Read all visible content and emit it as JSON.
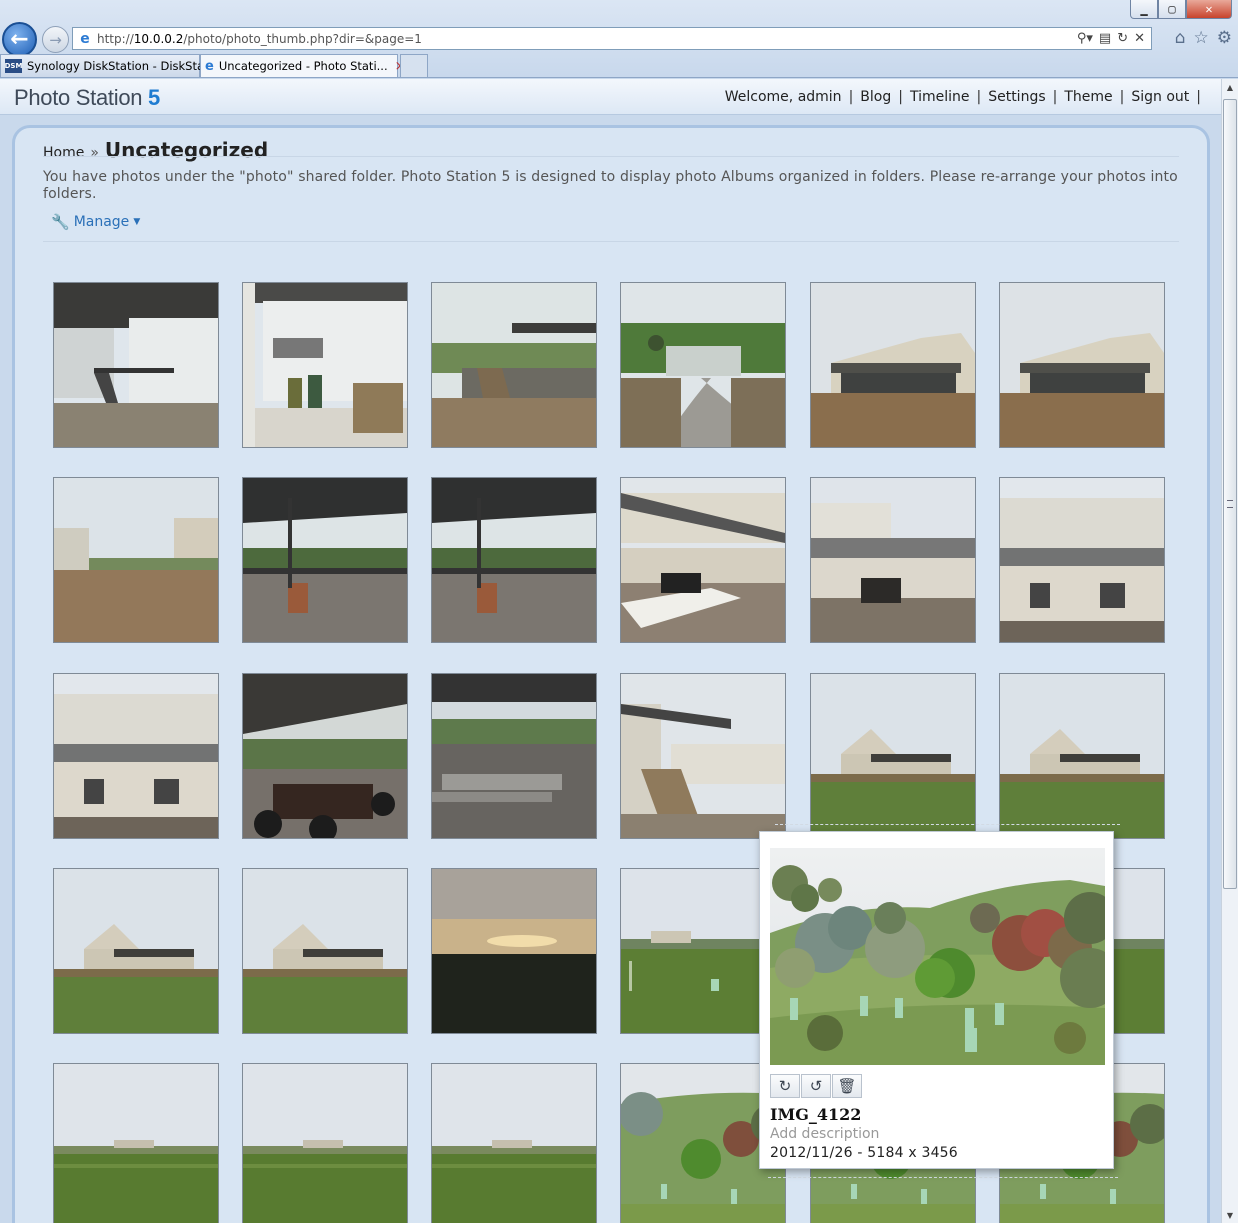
{
  "browser": {
    "address": {
      "prefix": "http://",
      "host": "10.0.0.2",
      "path": "/photo/photo_thumb.php?dir=&page=1"
    },
    "tabs": [
      {
        "label": "Synology DiskStation - DiskSta...",
        "icon": "dsm-icon"
      },
      {
        "label": "Uncategorized - Photo Stati...",
        "icon": "ie-icon",
        "active": true
      }
    ]
  },
  "header": {
    "logo_text": "Photo Station ",
    "logo_num": "5",
    "links": [
      "Welcome, admin",
      "Blog",
      "Timeline",
      "Settings",
      "Theme",
      "Sign out"
    ],
    "trailing_sep": "|"
  },
  "breadcrumb": {
    "home": "Home",
    "sep": "»",
    "current": "Uncategorized"
  },
  "notice": "You have photos under the \"photo\" shared folder. Photo Station 5 is designed to display photo Albums organized in folders. Please re-arrange your photos into folders.",
  "manage_label": "Manage",
  "thumbnails": [
    {
      "scene": "deck-side"
    },
    {
      "scene": "bbq-deck"
    },
    {
      "scene": "deck-stairs"
    },
    {
      "scene": "shed"
    },
    {
      "scene": "house-front"
    },
    {
      "scene": "house-front"
    },
    {
      "scene": "wall-view"
    },
    {
      "scene": "veranda"
    },
    {
      "scene": "veranda"
    },
    {
      "scene": "deck-table"
    },
    {
      "scene": "house-deck"
    },
    {
      "scene": "house-wall"
    },
    {
      "scene": "house-wall"
    },
    {
      "scene": "dining"
    },
    {
      "scene": "bench"
    },
    {
      "scene": "deck-stairs2"
    },
    {
      "scene": "house-hill"
    },
    {
      "scene": "house-hill"
    },
    {
      "scene": "house-hill"
    },
    {
      "scene": "house-hill"
    },
    {
      "scene": "sunset"
    },
    {
      "scene": "field"
    },
    {
      "scene": "field"
    },
    {
      "scene": "field"
    },
    {
      "scene": "field-far"
    },
    {
      "scene": "field-far"
    },
    {
      "scene": "field-far"
    },
    {
      "scene": "garden"
    },
    {
      "scene": "garden"
    },
    {
      "scene": "garden"
    }
  ],
  "popup": {
    "title": "IMG_4122",
    "description_placeholder": "Add description",
    "meta": "2012/11/26 - 5184 x 3456",
    "tools": [
      "rotate-cw-icon",
      "rotate-ccw-icon",
      "trash-icon"
    ]
  }
}
